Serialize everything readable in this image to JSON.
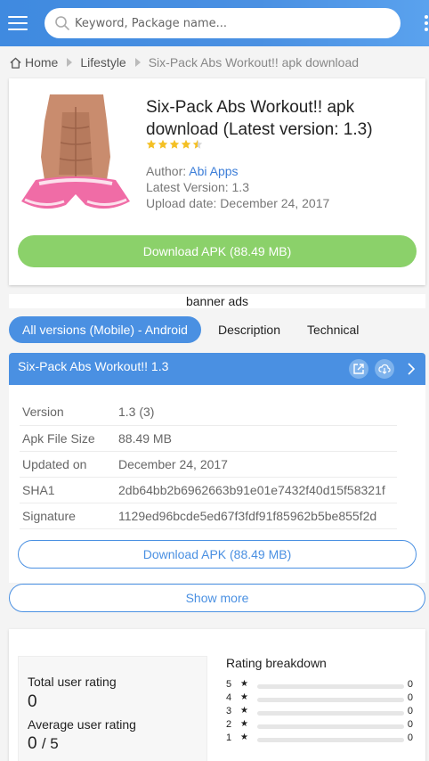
{
  "colors": {
    "accent": "#4a90e2",
    "download_green": "#8bd16a",
    "star_gold": "#f4c024"
  },
  "header": {
    "menu_icon": "hamburger-menu-icon",
    "search_placeholder": "Keyword, Package name...",
    "search_value": "",
    "more_icon": "vertical-dots-icon"
  },
  "breadcrumb": {
    "home": "Home",
    "category": "Lifestyle",
    "current": "Six-Pack Abs Workout!! apk download"
  },
  "app": {
    "title": "Six-Pack Abs Workout!! apk download (Latest version: 1.3)",
    "rating_stars": 4.5,
    "author_label": "Author: ",
    "author": "Abi Apps",
    "latest_version_label": "Latest Version: ",
    "latest_version": "1.3",
    "upload_date_label": "Upload date: ",
    "upload_date": "December 24, 2017",
    "download_label": "Download APK (88.49 MB)"
  },
  "banner": {
    "text": "banner ads"
  },
  "tabs": [
    {
      "label": "All versions (Mobile) - Android",
      "active": true
    },
    {
      "label": "Description",
      "active": false
    },
    {
      "label": "Technical",
      "active": false
    }
  ],
  "version_section": {
    "title": "Six-Pack Abs Workout!! 1.3",
    "icons": [
      "external-link-icon",
      "cloud-download-icon",
      "chevron-right-icon"
    ],
    "rows": [
      {
        "key": "Version",
        "value": "1.3 (3)"
      },
      {
        "key": "Apk File Size",
        "value": "88.49 MB"
      },
      {
        "key": "Updated on",
        "value": "December 24, 2017"
      },
      {
        "key": "SHA1",
        "value": "2db64bb2b6962663b91e01e7432f40d15f58321f"
      },
      {
        "key": "Signature",
        "value": "1129ed96bcde5ed67f3fdf91f85962b5be855f2d"
      }
    ],
    "download_label": "Download APK (88.49 MB)"
  },
  "show_more_label": "Show more",
  "rating": {
    "total_label": "Total user rating",
    "total_value": "0",
    "average_label": "Average user rating",
    "average_value": "0",
    "average_suffix": "/ 5",
    "breakdown_title": "Rating breakdown",
    "star_glyph": "★",
    "breakdown": [
      {
        "stars": "5",
        "count": "0",
        "fraction": 0
      },
      {
        "stars": "4",
        "count": "0",
        "fraction": 0
      },
      {
        "stars": "3",
        "count": "0",
        "fraction": 0
      },
      {
        "stars": "2",
        "count": "0",
        "fraction": 0
      },
      {
        "stars": "1",
        "count": "0",
        "fraction": 0
      }
    ]
  }
}
